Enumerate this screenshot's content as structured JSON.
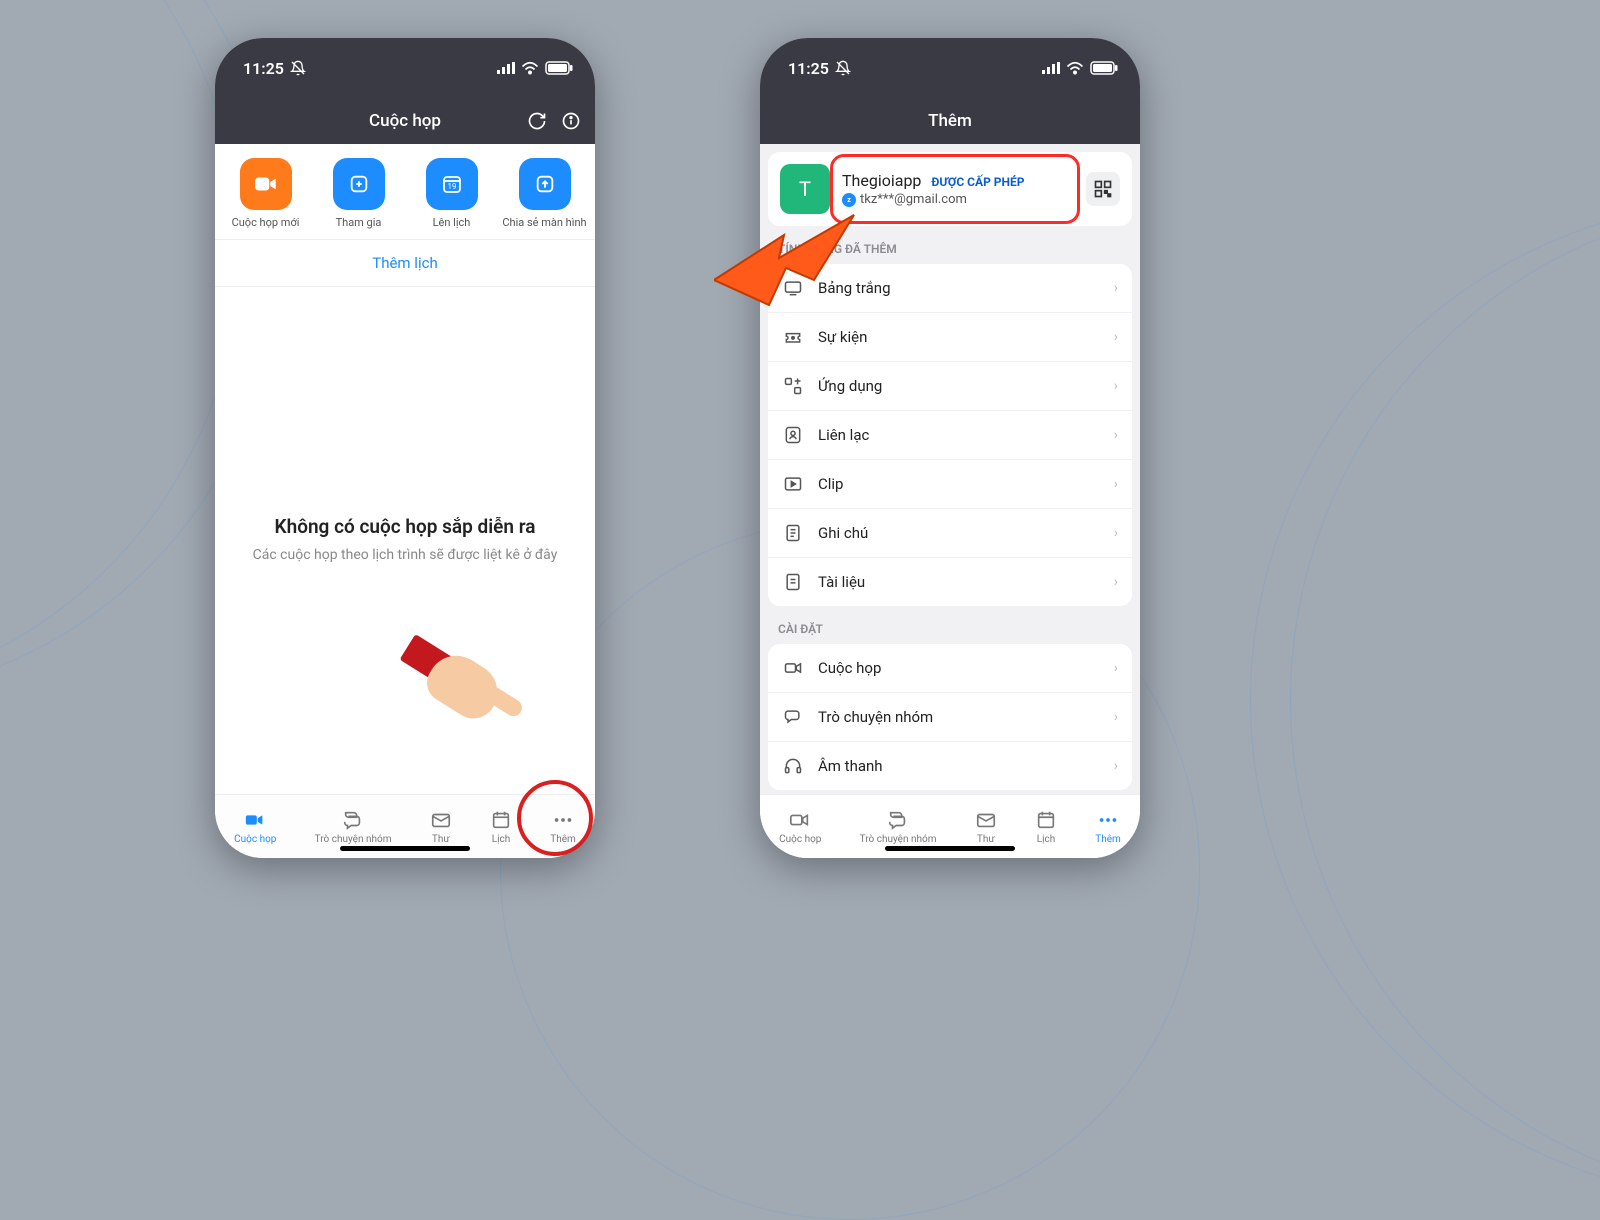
{
  "status": {
    "time": "11:25"
  },
  "phone1": {
    "header_title": "Cuộc họp",
    "actions": {
      "new_meeting": "Cuộc họp mới",
      "join": "Tham gia",
      "schedule": "Lên lịch",
      "calendar_day": "19",
      "share": "Chia sẻ màn hình"
    },
    "add_calendar": "Thêm lịch",
    "empty_title": "Không có cuộc họp sắp diễn ra",
    "empty_sub": "Các cuộc họp theo lịch trình sẽ được liệt kê ở đây"
  },
  "phone2": {
    "header_title": "Thêm",
    "profile": {
      "avatar_letter": "T",
      "name": "Thegioiapp",
      "badge": "ĐƯỢC CẤP PHÉP",
      "email": "tkz***@gmail.com"
    },
    "section_features": "TÍNH NĂNG ĐÃ THÊM",
    "features": [
      {
        "label": "Bảng trắng"
      },
      {
        "label": "Sự kiện"
      },
      {
        "label": "Ứng dụng"
      },
      {
        "label": "Liên lạc"
      },
      {
        "label": "Clip"
      },
      {
        "label": "Ghi chú"
      },
      {
        "label": "Tài liệu"
      }
    ],
    "section_settings": "CÀI ĐẶT",
    "settings": [
      {
        "label": "Cuộc họp"
      },
      {
        "label": "Trò chuyện nhóm"
      },
      {
        "label": "Âm thanh"
      }
    ]
  },
  "tabs": {
    "meetings": "Cuộc họp",
    "chat": "Trò chuyện nhóm",
    "mail": "Thư",
    "cal": "Lịch",
    "more": "Thêm"
  }
}
